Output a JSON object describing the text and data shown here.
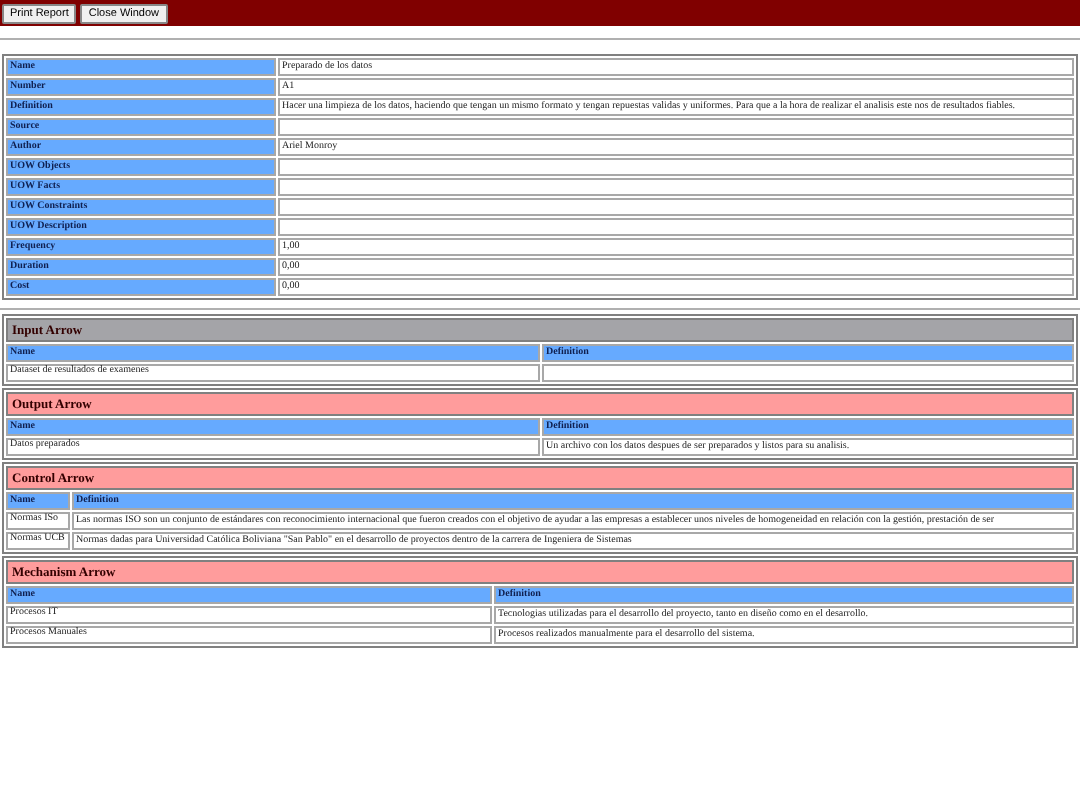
{
  "toolbar": {
    "buttons": [
      "Print Report",
      "Close Window"
    ]
  },
  "properties": [
    {
      "label": "Name",
      "value": "Preparado de los datos"
    },
    {
      "label": "Number",
      "value": "A1"
    },
    {
      "label": "Definition",
      "value": "Hacer una limpieza de los datos, haciendo que tengan un mismo formato y tengan repuestas validas y uniformes. Para que a la hora de realizar el analisis este nos de resultados fiables."
    },
    {
      "label": "Source"
    },
    {
      "label": "Author",
      "value": "Ariel Monroy"
    },
    {
      "label": "UOW Objects"
    },
    {
      "label": "UOW Facts"
    },
    {
      "label": "UOW Constraints"
    },
    {
      "label": "UOW Description"
    },
    {
      "label": "Frequency",
      "value": "1,00"
    },
    {
      "label": "Duration",
      "value": "0,00"
    },
    {
      "label": "Cost",
      "value": "0,00"
    }
  ],
  "sections": [
    {
      "title": "Input Arrow",
      "color": "#a4a4a8",
      "columns": [
        "Name",
        "Definition"
      ],
      "rows": [
        {
          "name": "Dataset de resultados de examenes"
        }
      ]
    },
    {
      "title": "Output Arrow",
      "color": "#ff9c9c",
      "columns": [
        "Name",
        "Definition"
      ],
      "rows": [
        {
          "name": "Datos preparados",
          "definition": "Un archivo con los datos despues de ser preparados y listos para su analisis."
        }
      ]
    },
    {
      "title": "Control Arrow",
      "color": "#ff9c9c",
      "columns": [
        "Name",
        "Definition"
      ],
      "rows": [
        {
          "name": "Normas ISo",
          "definition": "Las normas ISO son un conjunto de estándares con reconocimiento internacional que fueron creados con el objetivo de ayudar a las empresas a establecer unos niveles de homogeneidad en relación con la gestión, prestación de ser"
        },
        {
          "name": "Normas UCB",
          "definition": "Normas dadas para Universidad Católica Boliviana  \"San Pablo\" en el desarrollo de proyectos dentro de la carrera de Ingeniera de Sistemas"
        }
      ]
    },
    {
      "title": "Mechanism Arrow",
      "color": "#ff9c9c",
      "columns": [
        "Name",
        "Definition"
      ],
      "rows": [
        {
          "name": "Procesos IT",
          "definition": "Tecnologias utilizadas para el desarrollo del proyecto, tanto en diseño como en el desarrollo."
        },
        {
          "name": "Procesos Manuales",
          "definition": "Procesos realizados manualmente para el desarrollo del sistema."
        }
      ]
    }
  ]
}
